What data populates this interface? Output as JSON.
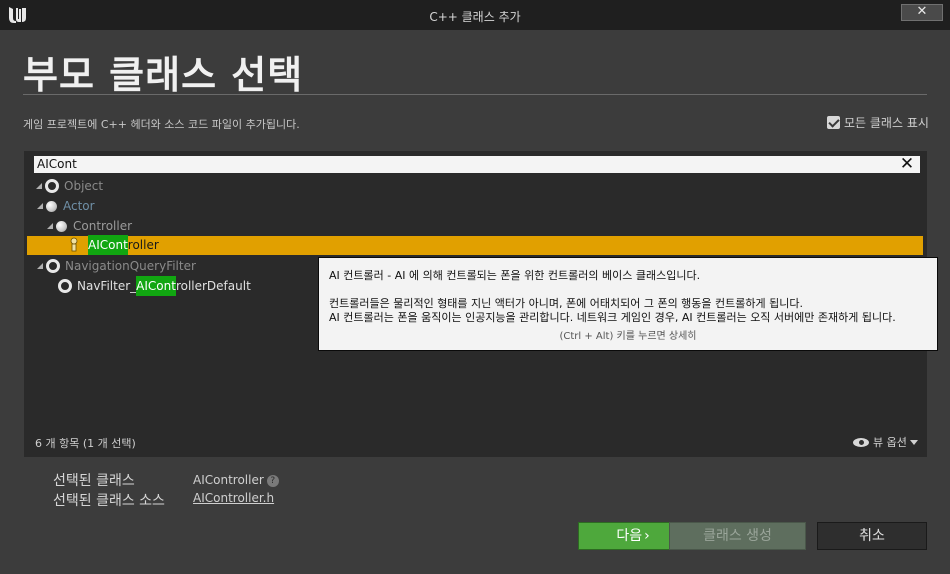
{
  "window": {
    "title": "C++ 클래스 추가",
    "close_label": "✕"
  },
  "header": {
    "title": "부모 클래스 선택",
    "description": "게임 프로젝트에 C++ 헤더와 소스 코드 파일이 추가됩니다."
  },
  "show_all_classes": {
    "label": "모든 클래스 표시",
    "checked": true
  },
  "search": {
    "value": "AICont",
    "clear_icon": "✕"
  },
  "tree": {
    "items": [
      {
        "label": "Object",
        "depth": 0
      },
      {
        "label": "Actor",
        "depth": 1
      },
      {
        "label": "Controller",
        "depth": 2
      },
      {
        "label_match": "AICont",
        "label_rest": "roller",
        "depth": 3,
        "selected": true
      },
      {
        "label": "NavigationQueryFilter",
        "depth": 0
      },
      {
        "label_prefix": "NavFilter_",
        "label_match": "AICont",
        "label_rest": "rollerDefault",
        "depth": 1
      }
    ]
  },
  "tooltip": {
    "line1": "AI 컨트롤러 - AI 에 의해 컨트롤되는 폰을 위한 컨트롤러의 베이스 클래스입니다.",
    "line2": "컨트롤러들은 물리적인 형태를 지닌 액터가 아니며, 폰에 어태치되어 그 폰의 행동을 컨트롤하게 됩니다.",
    "line3": "AI 컨트롤러는 폰을 움직이는 인공지능을 관리합니다. 네트워크 게임인 경우, AI 컨트롤러는 오직 서버에만 존재하게 됩니다.",
    "hint": "(Ctrl + Alt) 키를 누르면 상세히"
  },
  "footer": {
    "count": "6 개 항목 (1 개 선택)",
    "view_options": "뷰 옵션"
  },
  "selection": {
    "class_label": "선택된 클래스",
    "class_value": "AIController",
    "help_icon": "?",
    "source_label": "선택된 클래스 소스",
    "source_value": "AIController.h"
  },
  "buttons": {
    "next": "다음",
    "next_arrow": "›",
    "create": "클래스 생성",
    "cancel": "취소"
  }
}
